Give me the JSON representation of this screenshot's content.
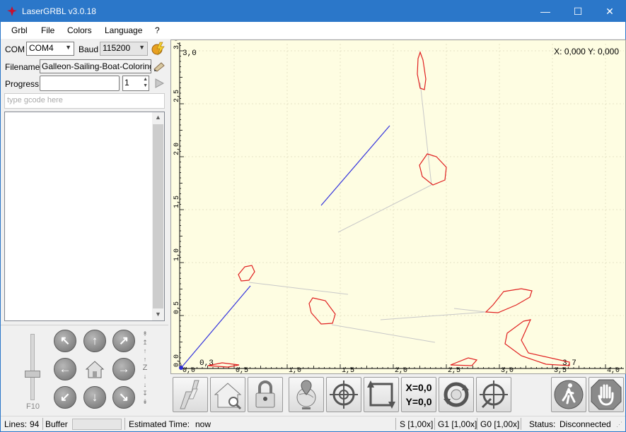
{
  "window": {
    "title": "LaserGRBL v3.0.18",
    "minimize": "—",
    "maximize": "☐",
    "close": "✕"
  },
  "menu": [
    "Grbl",
    "File",
    "Colors",
    "Language",
    "?"
  ],
  "connection": {
    "com_label": "COM",
    "com_value": "COM4",
    "baud_label": "Baud",
    "baud_value": "115200"
  },
  "file": {
    "filename_label": "Filename",
    "filename_value": "Galleon-Sailing-Boat-Coloring-Pag",
    "progress_label": "Progress",
    "copies_value": "1"
  },
  "gcode": {
    "placeholder": "type gcode here"
  },
  "jog": {
    "speed_label": "F10",
    "z_label": "Z"
  },
  "canvas": {
    "coords": "X: 0,000 Y: 0,000",
    "x_ticks": [
      "0,0",
      "0,5",
      "1,0",
      "1,5",
      "2,0",
      "2,5",
      "3,0",
      "3,5",
      "4,0"
    ],
    "y_ticks": [
      "0,0",
      "0,5",
      "1,0",
      "1,5",
      "2,0",
      "2,5",
      "3,0"
    ],
    "corner_top": "3,0",
    "corner_bottom_left": "0,3",
    "corner_bottom_right": "3,7"
  },
  "toolbar": [
    "laser-flash-icon",
    "homing-icon",
    "unlock-icon",
    "goto-origin-globe-icon",
    "center-target-icon",
    "frame-corners-icon",
    "reset-zero-icon",
    "rotate-recycle-icon",
    "target-zero-icon",
    "walk-person-icon",
    "stop-hand-icon"
  ],
  "zero_button": {
    "x": "X=0,0",
    "y": "Y=0,0"
  },
  "status": {
    "lines_label": "Lines:",
    "lines_value": "94",
    "buffer_label": "Buffer",
    "time_label": "Estimated Time:",
    "time_value": "now",
    "s_override": "S [1,00x]",
    "g1_override": "G1 [1,00x]",
    "g0_override": "G0 [1,00x]",
    "status_label": "Status:",
    "status_value": "Disconnected"
  },
  "colors": {
    "titlebar": "#2b77c9",
    "canvas_bg": "#fefde2",
    "path_red": "#e02020",
    "path_blue": "#3030e0"
  }
}
